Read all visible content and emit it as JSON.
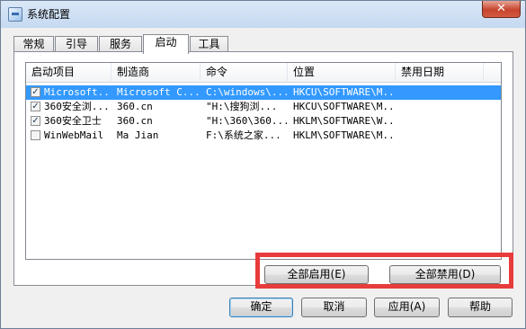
{
  "window": {
    "title": "系统配置",
    "close_glyph": "✕"
  },
  "tabs": [
    {
      "label": "常规",
      "active": false
    },
    {
      "label": "引导",
      "active": false
    },
    {
      "label": "服务",
      "active": false
    },
    {
      "label": "启动",
      "active": true
    },
    {
      "label": "工具",
      "active": false
    }
  ],
  "startup_list": {
    "columns": [
      "启动项目",
      "制造商",
      "命令",
      "位置",
      "禁用日期"
    ],
    "rows": [
      {
        "checked": true,
        "selected": true,
        "item": "Microsoft...",
        "maker": "Microsoft C...",
        "command": "C:\\windows\\...",
        "location": "HKCU\\SOFTWARE\\M...",
        "disabled_date": ""
      },
      {
        "checked": true,
        "selected": false,
        "item": "360安全浏...",
        "maker": "360.cn",
        "command": "\"H:\\搜狗浏...",
        "location": "HKCU\\SOFTWARE\\M...",
        "disabled_date": ""
      },
      {
        "checked": true,
        "selected": false,
        "item": "360安全卫士",
        "maker": "360.cn",
        "command": "\"H:\\360\\360...",
        "location": "HKLM\\SOFTWARE\\W...",
        "disabled_date": ""
      },
      {
        "checked": false,
        "selected": false,
        "item": "WinWebMail",
        "maker": "Ma Jian",
        "command": "F:\\系统之家...",
        "location": "HKLM\\SOFTWARE\\M...",
        "disabled_date": ""
      }
    ]
  },
  "panel_buttons": {
    "enable_all": "全部启用(E)",
    "disable_all": "全部禁用(D)"
  },
  "dialog_buttons": {
    "ok": "确定",
    "cancel": "取消",
    "apply": "应用(A)",
    "help": "帮助"
  },
  "colors": {
    "selection": "#3399ff",
    "highlight_box": "#e83b3b"
  },
  "icons": {
    "title": "msconfig-icon",
    "checkmark": "✓"
  }
}
